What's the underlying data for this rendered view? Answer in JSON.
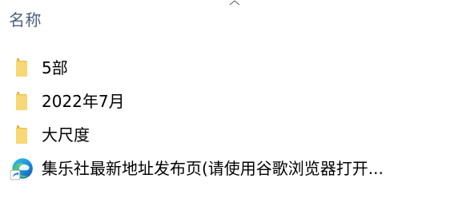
{
  "header": {
    "name_column_label": "名称"
  },
  "files": [
    {
      "name": "5部",
      "icon": "folder-icon"
    },
    {
      "name": "2022年7月",
      "icon": "folder-icon"
    },
    {
      "name": "大尺度",
      "icon": "folder-icon"
    },
    {
      "name": "集乐社最新地址发布页(请使用谷歌浏览器打开...",
      "icon": "edge-shortcut-icon"
    }
  ],
  "colors": {
    "header_text": "#4c607a",
    "folder_yellow": "#f8d775",
    "folder_dark": "#e0b84b"
  }
}
